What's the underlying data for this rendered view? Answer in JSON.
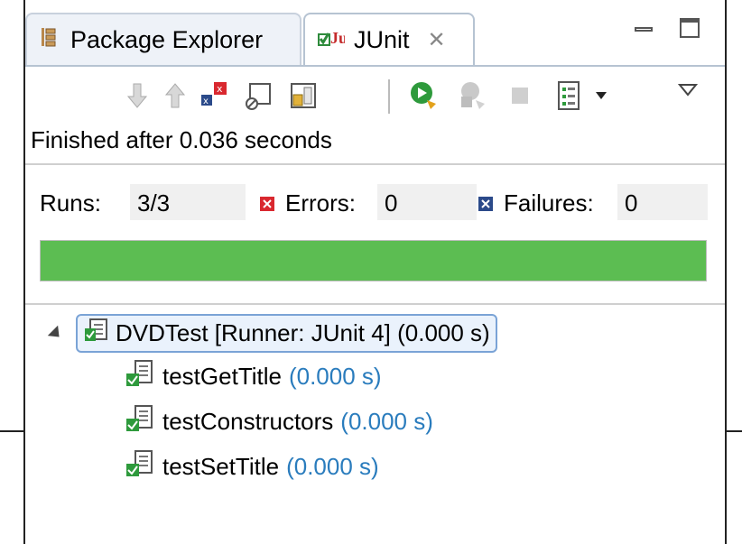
{
  "tabs": [
    {
      "label": "Package Explorer",
      "icon": "package-explorer-icon",
      "active": false
    },
    {
      "label": "JUnit",
      "icon": "junit-icon",
      "active": true,
      "close_glyph": "✕"
    }
  ],
  "toolbar": {
    "icons": [
      "next-failure-icon",
      "previous-failure-icon",
      "show-failures-only-icon",
      "scroll-lock-icon",
      "test-run-session-icon",
      "rerun-test-icon",
      "rerun-failed-first-icon",
      "stop-icon",
      "test-history-icon",
      "history-dropdown-icon",
      "view-menu-icon"
    ]
  },
  "status": "Finished after 0.036 seconds",
  "counters": {
    "runs_label": "Runs:",
    "runs_value": "3/3",
    "errors_label": "Errors:",
    "errors_value": "0",
    "failures_label": "Failures:",
    "failures_value": "0"
  },
  "progress": {
    "fraction": 1.0,
    "color": "#5cbd52"
  },
  "tree": {
    "suite": {
      "label": "DVDTest [Runner: JUnit 4] (0.000 s)",
      "expanded": true
    },
    "tests": [
      {
        "name": "testGetTitle",
        "time": "(0.000 s)"
      },
      {
        "name": "testConstructors",
        "time": "(0.000 s)"
      },
      {
        "name": "testSetTitle",
        "time": "(0.000 s)"
      }
    ]
  },
  "colors": {
    "accent_blue": "#2a7cbd",
    "pass_green": "#5cbd52",
    "error_red": "#d9282f",
    "failure_blue": "#2b4a8a"
  }
}
